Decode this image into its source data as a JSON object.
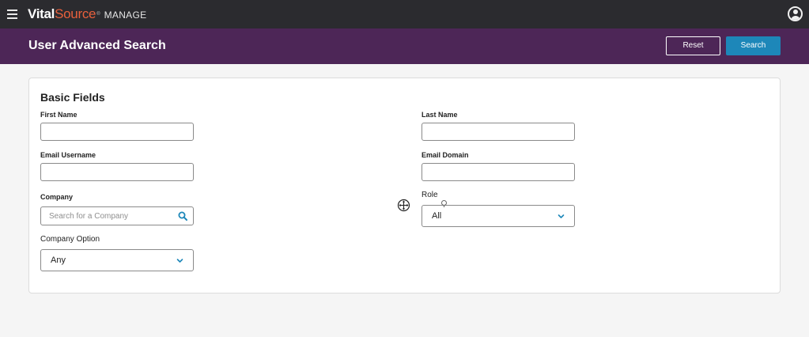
{
  "brand": {
    "vital": "Vital",
    "source": "Source",
    "reg": "®",
    "product": "MANAGE"
  },
  "header": {
    "title": "User Advanced Search",
    "reset_label": "Reset",
    "search_label": "Search"
  },
  "form": {
    "section_title": "Basic Fields",
    "first_name": {
      "label": "First Name",
      "value": ""
    },
    "last_name": {
      "label": "Last Name",
      "value": ""
    },
    "email_username": {
      "label": "Email Username",
      "value": ""
    },
    "email_domain": {
      "label": "Email Domain",
      "value": ""
    },
    "company": {
      "label": "Company",
      "placeholder": "Search for a Company",
      "value": ""
    },
    "role": {
      "label": "Role",
      "selected": "All"
    },
    "company_option": {
      "label": "Company Option",
      "selected": "Any"
    }
  },
  "colors": {
    "topbar": "#2b2b2f",
    "titlebar": "#4d2657",
    "accent": "#1d87b9",
    "brand_orange": "#e8603c"
  },
  "icons": {
    "menu": "hamburger-icon",
    "account": "user-circle-icon",
    "company_search": "magnifier-icon",
    "dropdown": "chevron-down-icon",
    "cursor": "move-cursor-icon"
  }
}
